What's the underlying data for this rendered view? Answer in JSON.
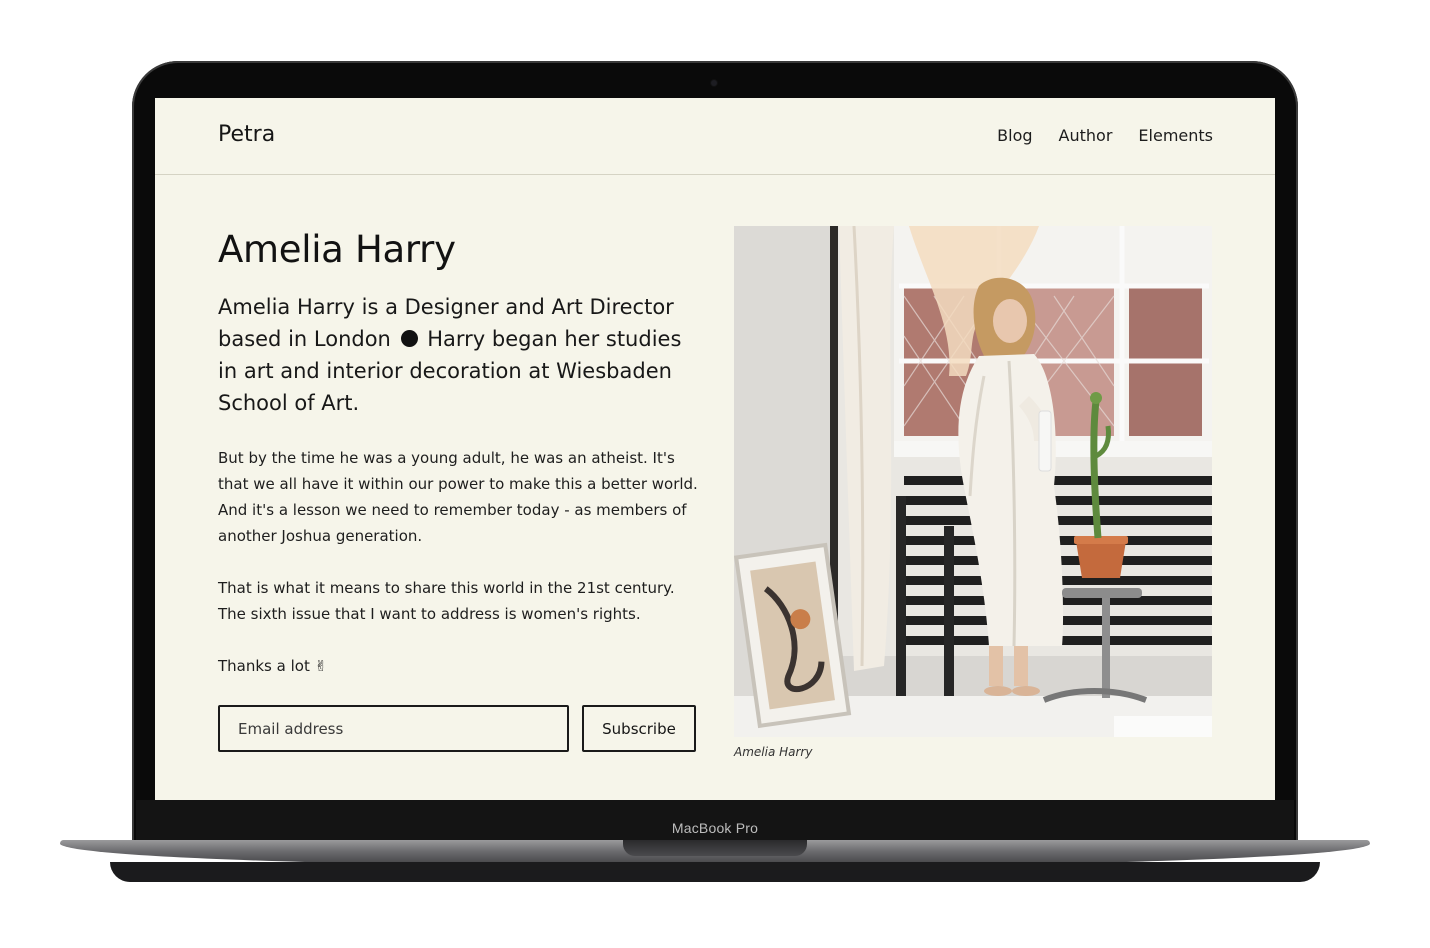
{
  "device": {
    "label": "MacBook Pro"
  },
  "site": {
    "logo": "Petra",
    "nav": [
      {
        "label": "Blog"
      },
      {
        "label": "Author"
      },
      {
        "label": "Elements"
      }
    ]
  },
  "author": {
    "title": "Amelia Harry",
    "lead_part1": "Amelia Harry is a Designer and Art Director based in London",
    "lead_part2": "Harry began her studies in art and interior decoration at Wiesbaden School of Art.",
    "paragraph1": "But by the time he was a young adult, he was an atheist. It's that we all have it within our power to make this a better world. And it's a lesson we need to remember today - as members of another Joshua generation.",
    "paragraph2": "That is what it means to share this world in the 21st century. The sixth issue that I want to address is women's rights.",
    "thanks": "Thanks a lot ✌",
    "photo_caption": "Amelia Harry"
  },
  "subscribe": {
    "email_placeholder": "Email address",
    "button_label": "Subscribe"
  },
  "colors": {
    "page_background": "#f6f5ea",
    "text": "#121212",
    "laptop_frame": "#0a0a0a"
  }
}
